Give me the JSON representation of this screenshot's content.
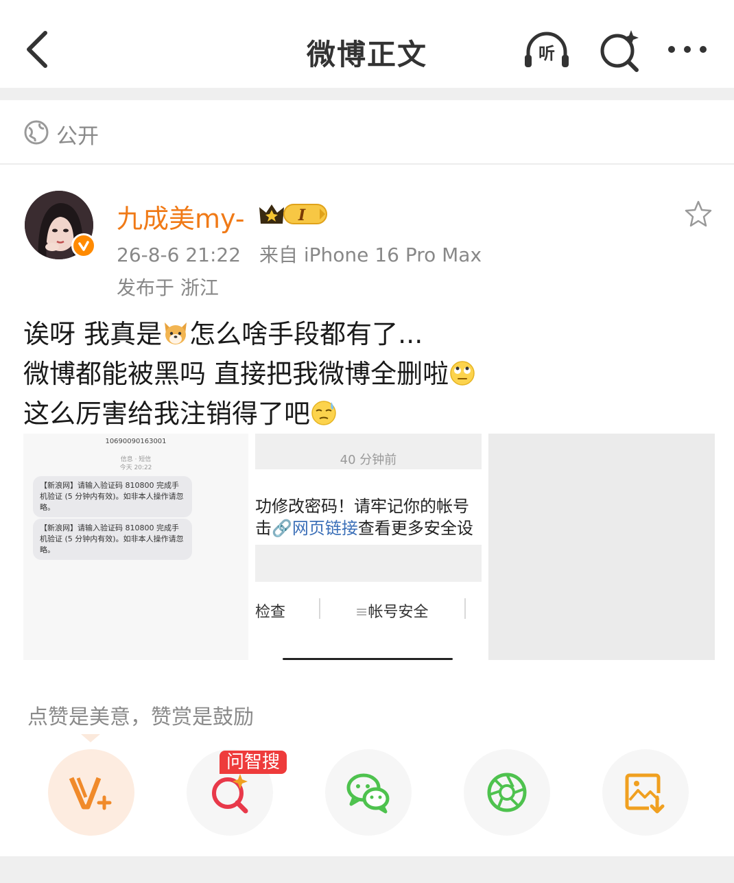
{
  "header": {
    "title": "微博正文",
    "back_icon": "back-arrow-icon",
    "listen_icon_label": "听",
    "icons": [
      "headphones-listen-icon",
      "ai-search-icon",
      "more-dots-icon"
    ]
  },
  "visibility": {
    "label": "公开",
    "icon": "globe-icon"
  },
  "post": {
    "author": "九成美my-",
    "badge_level": "I",
    "time": "26-8-6 21:22",
    "source": "来自 iPhone 16 Pro Max",
    "location": "发布于 浙江",
    "lines": [
      {
        "text": "诶呀 我真是",
        "emoji": "dog-face-emoji",
        "after": "怎么啥手段都有了..."
      },
      {
        "text": "微博都能被黑吗 直接把我微博全删啦",
        "emoji": "eye-roll-emoji",
        "after": ""
      },
      {
        "text": "这么厉害给我注销得了吧",
        "emoji": "sweat-face-emoji",
        "after": ""
      }
    ]
  },
  "images": {
    "sms": {
      "number": "10690090163001",
      "sub1": "信息 · 短信",
      "sub2": "今天 20:22",
      "messages": [
        "【新浪网】请输入验证码 810800 完成手机验证 (5 分钟内有效)。如非本人操作请忽略。",
        "【新浪网】请输入验证码 810800 完成手机验证 (5 分钟内有效)。如非本人操作请忽略。"
      ]
    },
    "notice": {
      "time": "40 分钟前",
      "line1": "功修改密码！请牢记你的帐号",
      "line2_prefix": "击",
      "line2_link": "网页链接",
      "line2_suffix": "查看更多安全设",
      "tab_a": "检查",
      "tab_b": "帐号安全",
      "tab_b_icon": "≡"
    }
  },
  "reward_text": "点赞是美意，赞赏是鼓励",
  "share": {
    "ai_badge": "问智搜",
    "buttons": [
      "v-plus-icon",
      "ai-search-icon",
      "wechat-icon",
      "moments-icon",
      "save-image-icon"
    ]
  },
  "colors": {
    "accent": "#f07a17",
    "link": "#3b6fb8",
    "badge_red": "#ee3b3b",
    "wechat": "#4ec24e"
  }
}
